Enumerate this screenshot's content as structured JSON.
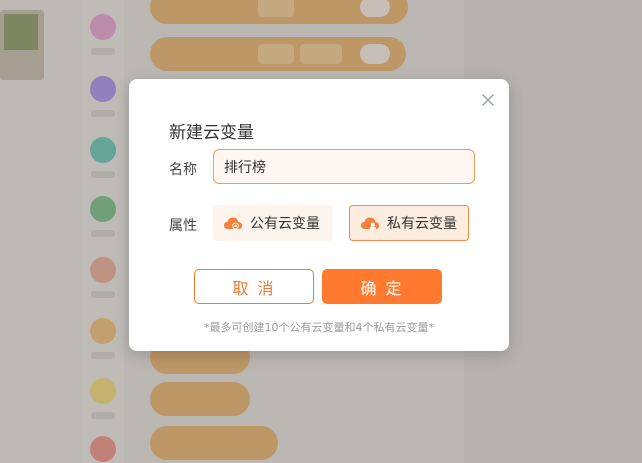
{
  "dialog": {
    "title": "新建云变量",
    "name_label": "名称",
    "name_value": "排行榜",
    "attribute_label": "属性",
    "option_public": "公有云变量",
    "option_private": "私有云变量",
    "selected_option": "私有云变量",
    "cancel_label": "取 消",
    "confirm_label": "确 定",
    "note": "*最多可创建10个公有云变量和4个私有云变量*"
  },
  "icons": {
    "close": "close-icon",
    "public_cloud": "cloud-public-icon",
    "private_cloud": "cloud-private-icon"
  },
  "colors": {
    "accent": "#ff7a2e",
    "input_border": "#f29b5c",
    "selected_bg": "#fdece0"
  }
}
